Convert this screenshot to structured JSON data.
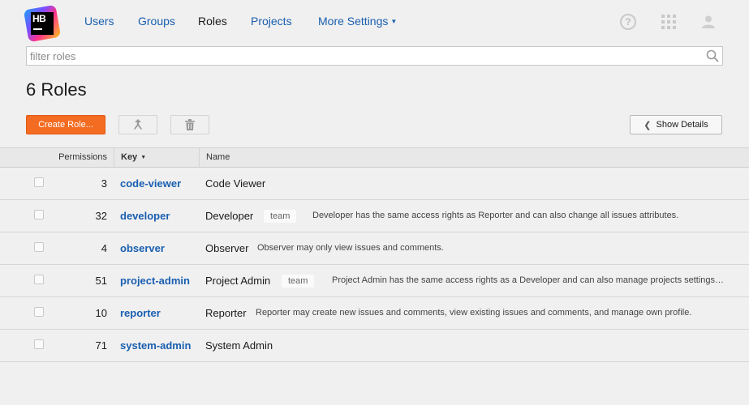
{
  "logo": {
    "text": "HB"
  },
  "nav": {
    "items": [
      {
        "label": "Users"
      },
      {
        "label": "Groups"
      },
      {
        "label": "Roles"
      },
      {
        "label": "Projects"
      },
      {
        "label": "More Settings"
      }
    ]
  },
  "header_icons": [
    "help-icon",
    "apps-grid-icon",
    "user-avatar-icon"
  ],
  "search": {
    "placeholder": "filter roles",
    "value": ""
  },
  "page": {
    "title": "6 Roles"
  },
  "toolbar": {
    "create_label": "Create Role...",
    "merge_icon": "merge-icon",
    "delete_icon": "trash-icon",
    "details_label": "Show Details"
  },
  "table": {
    "headers": {
      "permissions": "Permissions",
      "key": "Key",
      "name": "Name"
    },
    "rows": [
      {
        "permissions": "3",
        "key": "code-viewer",
        "name": "Code Viewer",
        "tag": "",
        "description": ""
      },
      {
        "permissions": "32",
        "key": "developer",
        "name": "Developer",
        "tag": "team",
        "description": "Developer has the same access rights as Reporter and can also change all issues attributes."
      },
      {
        "permissions": "4",
        "key": "observer",
        "name": "Observer",
        "tag": "",
        "description": "Observer may only view issues and comments."
      },
      {
        "permissions": "51",
        "key": "project-admin",
        "name": "Project Admin",
        "tag": "team",
        "description": "Project Admin has the same access rights as a Developer and can also manage projects settings…"
      },
      {
        "permissions": "10",
        "key": "reporter",
        "name": "Reporter",
        "tag": "",
        "description": "Reporter may create new issues and comments, view existing issues and comments, and manage own profile."
      },
      {
        "permissions": "71",
        "key": "system-admin",
        "name": "System Admin",
        "tag": "",
        "description": ""
      }
    ]
  },
  "colors": {
    "accent": "#f46b22",
    "link": "#1a5fb0",
    "background": "#f0f0f0"
  }
}
